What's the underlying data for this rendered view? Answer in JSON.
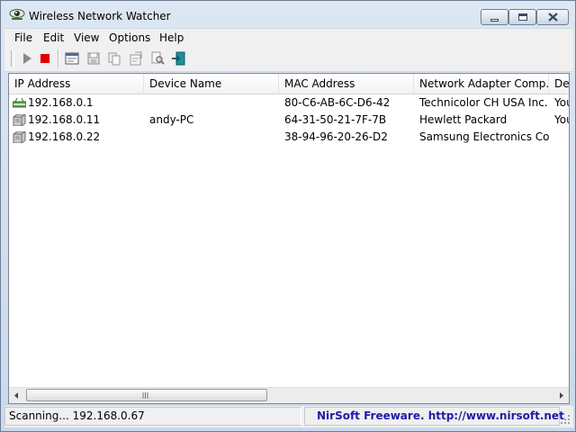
{
  "window": {
    "title": "Wireless Network Watcher"
  },
  "menu": [
    "File",
    "Edit",
    "View",
    "Options",
    "Help"
  ],
  "toolbar": {
    "buttons": [
      "start-icon",
      "stop-icon",
      "properties-icon",
      "save-icon",
      "copy-icon",
      "report-icon",
      "search-icon",
      "exit-icon"
    ]
  },
  "table": {
    "columns": [
      "IP Address",
      "Device Name",
      "MAC Address",
      "Network Adapter Comp...",
      "Dev"
    ],
    "rows": [
      {
        "icon": "router-icon",
        "ip": "192.168.0.1",
        "device": "",
        "mac": "80-C6-AB-6C-D6-42",
        "vendor": "Technicolor CH USA Inc.",
        "extra": "You"
      },
      {
        "icon": "computer-icon",
        "ip": "192.168.0.11",
        "device": "andy-PC",
        "mac": "64-31-50-21-7F-7B",
        "vendor": "Hewlett Packard",
        "extra": "You"
      },
      {
        "icon": "computer-icon",
        "ip": "192.168.0.22",
        "device": "",
        "mac": "38-94-96-20-26-D2",
        "vendor": "Samsung Electronics Co...",
        "extra": ""
      }
    ]
  },
  "status": {
    "left": "Scanning... 192.168.0.67",
    "right": "NirSoft Freeware.  http://www.nirsoft.net"
  },
  "colors": {
    "link": "#1c1ca8",
    "stop": "#e00000",
    "play": "#8a8a8a"
  }
}
